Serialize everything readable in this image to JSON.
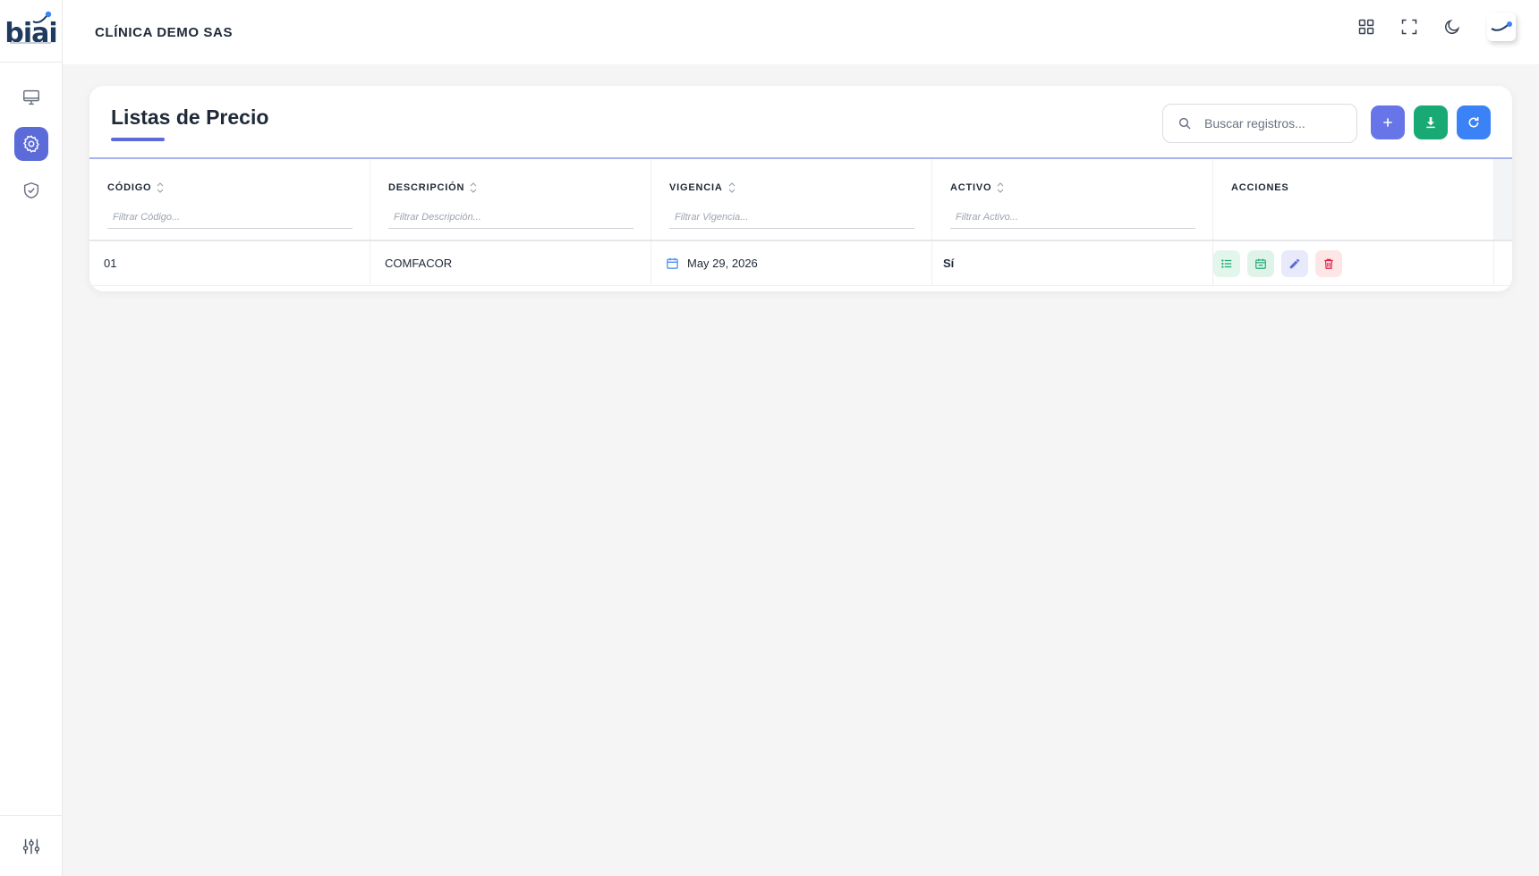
{
  "brand": {
    "logo_text": "biai"
  },
  "header": {
    "company": "CLÍNICA DEMO SAS"
  },
  "page": {
    "title": "Listas de Precio",
    "search_placeholder": "Buscar registros..."
  },
  "table": {
    "columns": [
      {
        "label": "CÓDIGO",
        "filter_placeholder": "Filtrar Código..."
      },
      {
        "label": "DESCRIPCIÓN",
        "filter_placeholder": "Filtrar Descripción..."
      },
      {
        "label": "VIGENCIA",
        "filter_placeholder": "Filtrar Vigencia..."
      },
      {
        "label": "ACTIVO",
        "filter_placeholder": "Filtrar Activo..."
      },
      {
        "label": "ACCIONES"
      }
    ],
    "rows": [
      {
        "codigo": "01",
        "descripcion": "COMFACOR",
        "vigencia": "May 29, 2026",
        "activo": "Sí"
      }
    ]
  },
  "colors": {
    "primary": "#5b6cd9",
    "success": "#19a974",
    "info": "#3b82f6",
    "danger": "#e11d48"
  }
}
